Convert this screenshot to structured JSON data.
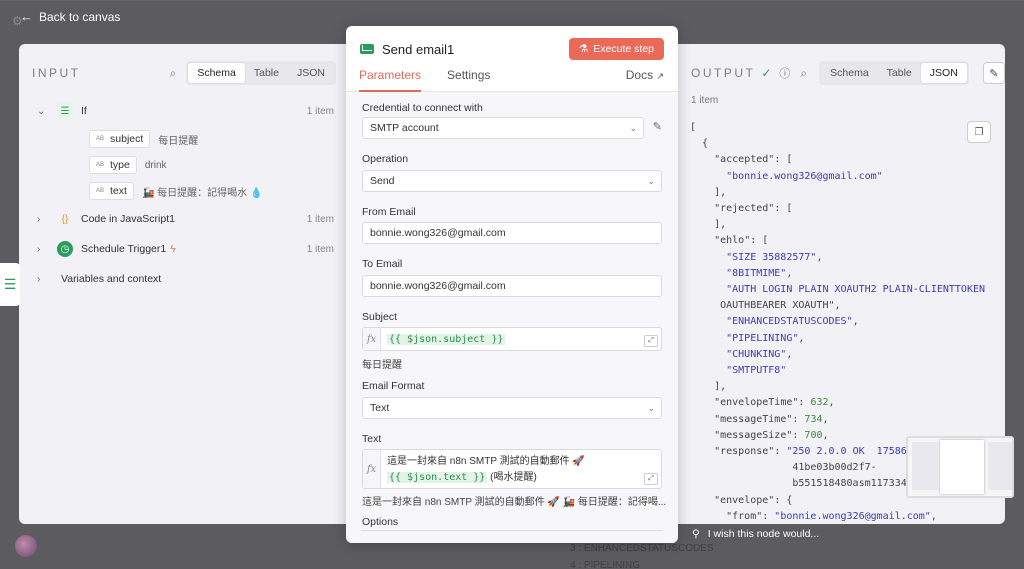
{
  "back_label": "Back to canvas",
  "input": {
    "title": "INPUT",
    "view_tabs": [
      "Schema",
      "Table",
      "JSON"
    ],
    "active_tab": "Schema",
    "tree": [
      {
        "name": "If",
        "count": "1 item",
        "expanded": true,
        "fields": [
          {
            "key": "subject",
            "value": "每日提醒"
          },
          {
            "key": "type",
            "value": "drink"
          },
          {
            "key": "text",
            "value": "🚂 每日提醒：記得喝水 💧"
          }
        ]
      },
      {
        "name": "Code in JavaScript1",
        "count": "1 item"
      },
      {
        "name": "Schedule Trigger1",
        "count": "1 item"
      },
      {
        "name": "Variables and context"
      }
    ]
  },
  "params": {
    "node_title": "Send email1",
    "execute_label": "Execute step",
    "tabs": [
      "Parameters",
      "Settings"
    ],
    "docs_label": "Docs",
    "credential_label": "Credential to connect with",
    "credential_value": "SMTP account",
    "operation_label": "Operation",
    "operation_value": "Send",
    "from_label": "From Email",
    "from_value": "bonnie.wong326@gmail.com",
    "to_label": "To Email",
    "to_value": "bonnie.wong326@gmail.com",
    "subject_label": "Subject",
    "subject_expr": "{{ $json.subject }}",
    "subject_preview": "每日提醒",
    "format_label": "Email Format",
    "format_value": "Text",
    "text_label": "Text",
    "text_line1": "這是一封來自 n8n SMTP 測試的自動郵件 🚀",
    "text_expr": "{{ $json.text }}",
    "text_suffix": "(喝水提醒)",
    "text_preview": "這是一封來自 n8n SMTP 測試的自動郵件 🚀 🚂 每日提醒：記得喝...",
    "options_label": "Options"
  },
  "output": {
    "title": "OUTPUT",
    "item_count": "1 item",
    "view_tabs": [
      "Schema",
      "Table",
      "JSON"
    ],
    "active_tab": "JSON",
    "json_lines": [
      "[",
      "  {",
      "    \"accepted\": [",
      "      \"bonnie.wong326@gmail.com\"",
      "    ],",
      "    \"rejected\": [",
      "    ],",
      "    \"ehlo\": [",
      "      \"SIZE 35882577\",",
      "      \"8BITMIME\",",
      "      \"AUTH LOGIN PLAIN XOAUTH2 PLAIN-CLIENTTOKEN",
      "     OAUTHBEARER XOAUTH\",",
      "      \"ENHANCEDSTATUSCODES\",",
      "      \"PIPELINING\",",
      "      \"CHUNKING\",",
      "      \"SMTPUTF8\"",
      "    ],",
      "    \"envelopeTime\": 632,",
      "    \"messageTime\": 734,",
      "    \"messageSize\": 700,",
      "    \"response\": \"250 2.0.0 OK  175861",
      "                 41be03b00d2f7-",
      "                 b551518480asm11733437",
      "    \"envelope\": {",
      "      \"from\": \"bonnie.wong326@gmail.com\","
    ]
  },
  "wish_label": "I wish this node would...",
  "bg_hints": [
    "3 : ENHANCEDSTATUSCODES",
    "4 : PIPELINING"
  ]
}
